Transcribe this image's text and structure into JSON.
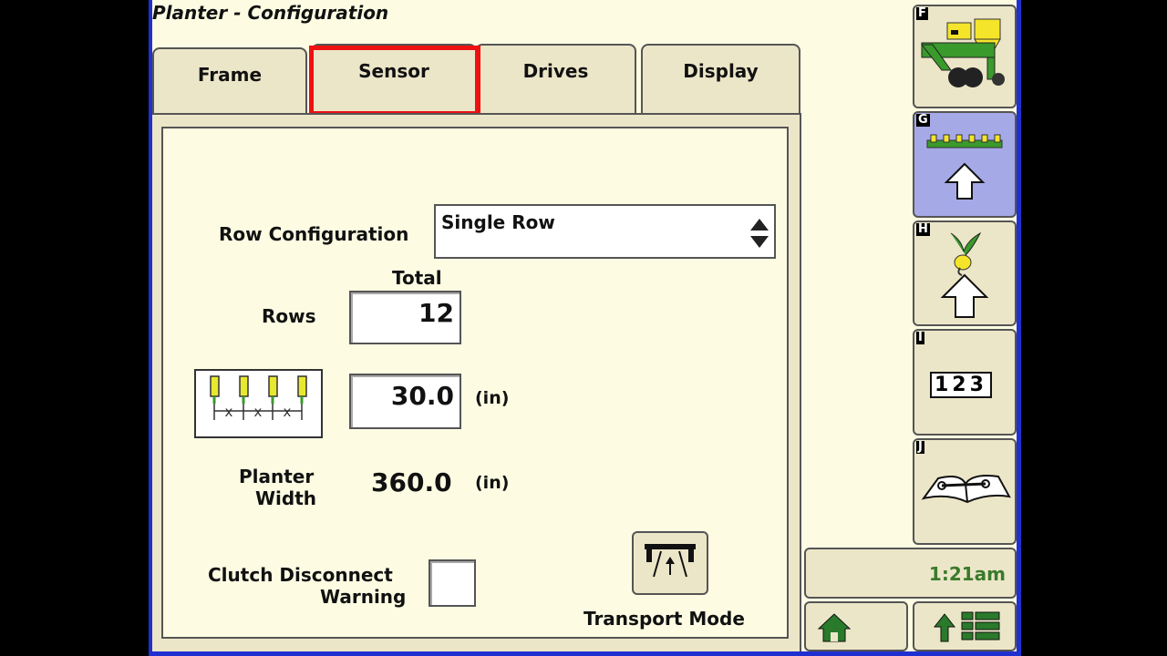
{
  "window": {
    "title": "Planter - Configuration"
  },
  "tabs": [
    {
      "label": "Frame"
    },
    {
      "label": "Sensor"
    },
    {
      "label": "Drives"
    },
    {
      "label": "Display"
    }
  ],
  "form": {
    "row_config_label": "Row Configuration",
    "row_config_value": "Single Row",
    "total_label": "Total",
    "rows_label": "Rows",
    "rows_value": "12",
    "row_spacing_value": "30.0",
    "row_spacing_unit": "(in)",
    "planter_width_label_1": "Planter",
    "planter_width_label_2": "Width",
    "planter_width_value": "360.0",
    "planter_width_unit": "(in)",
    "clutch_label_1": "Clutch Disconnect",
    "clutch_label_2": "Warning",
    "clutch_checked": false,
    "transport_mode_label": "Transport Mode"
  },
  "sidebar": {
    "items": [
      {
        "key": "F",
        "icon": "planter-icon"
      },
      {
        "key": "G",
        "icon": "implement-up-icon",
        "active": true
      },
      {
        "key": "H",
        "icon": "seed-up-icon"
      },
      {
        "key": "I",
        "icon": "numbers-123-icon",
        "text": "123"
      },
      {
        "key": "J",
        "icon": "manual-book-icon"
      }
    ]
  },
  "status": {
    "time": "1:21am"
  },
  "colors": {
    "accent_blue": "#2030d0",
    "highlight_red": "#ee1111",
    "time_green": "#3a7a2c"
  }
}
